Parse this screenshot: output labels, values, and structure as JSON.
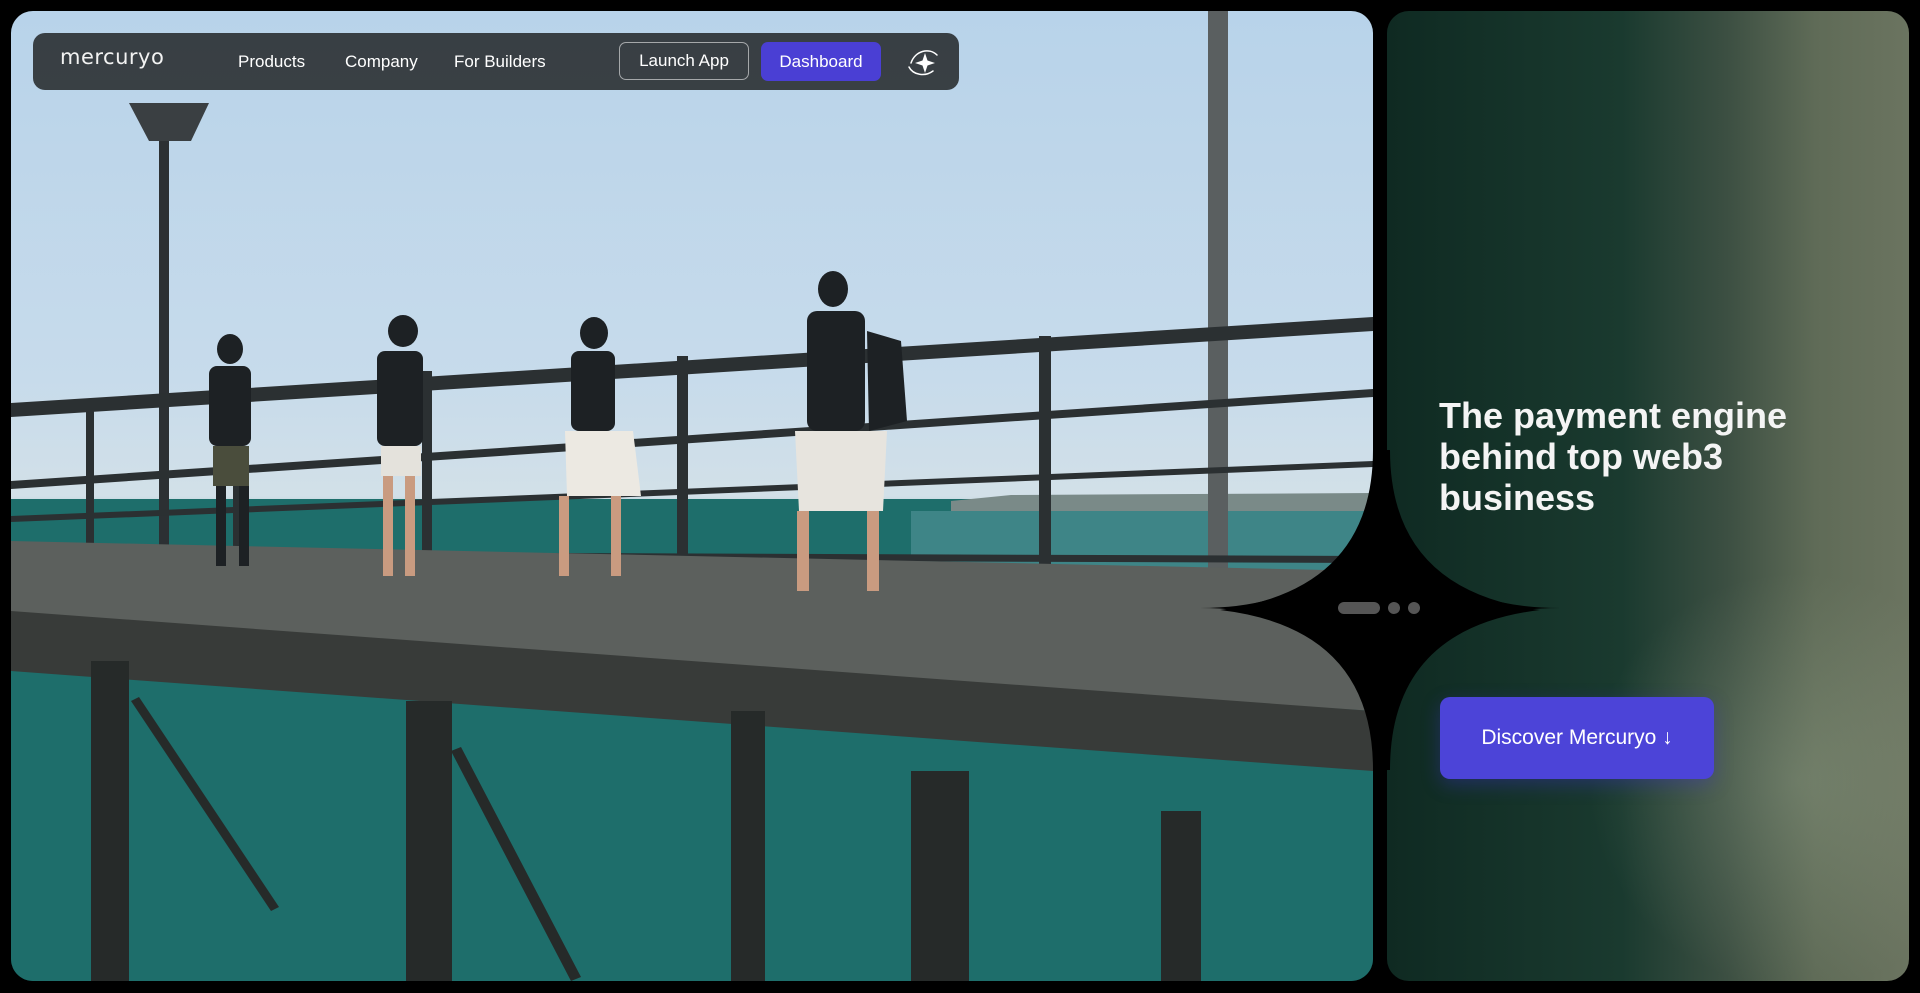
{
  "nav": {
    "logo": "mercuryo",
    "links": [
      "Products",
      "Company",
      "For Builders"
    ],
    "launch_label": "Launch App",
    "dashboard_label": "Dashboard",
    "sparkle_icon": "sparkle-icon"
  },
  "hero": {
    "headline": "The payment engine behind top web3 business",
    "cta_label": "Discover Mercuryo ↓",
    "slides": {
      "count": 3,
      "active": 1
    }
  },
  "colors": {
    "accent": "#4a3fd4",
    "panel_dark": "#0f2a22",
    "panel_light": "#6b7460"
  }
}
